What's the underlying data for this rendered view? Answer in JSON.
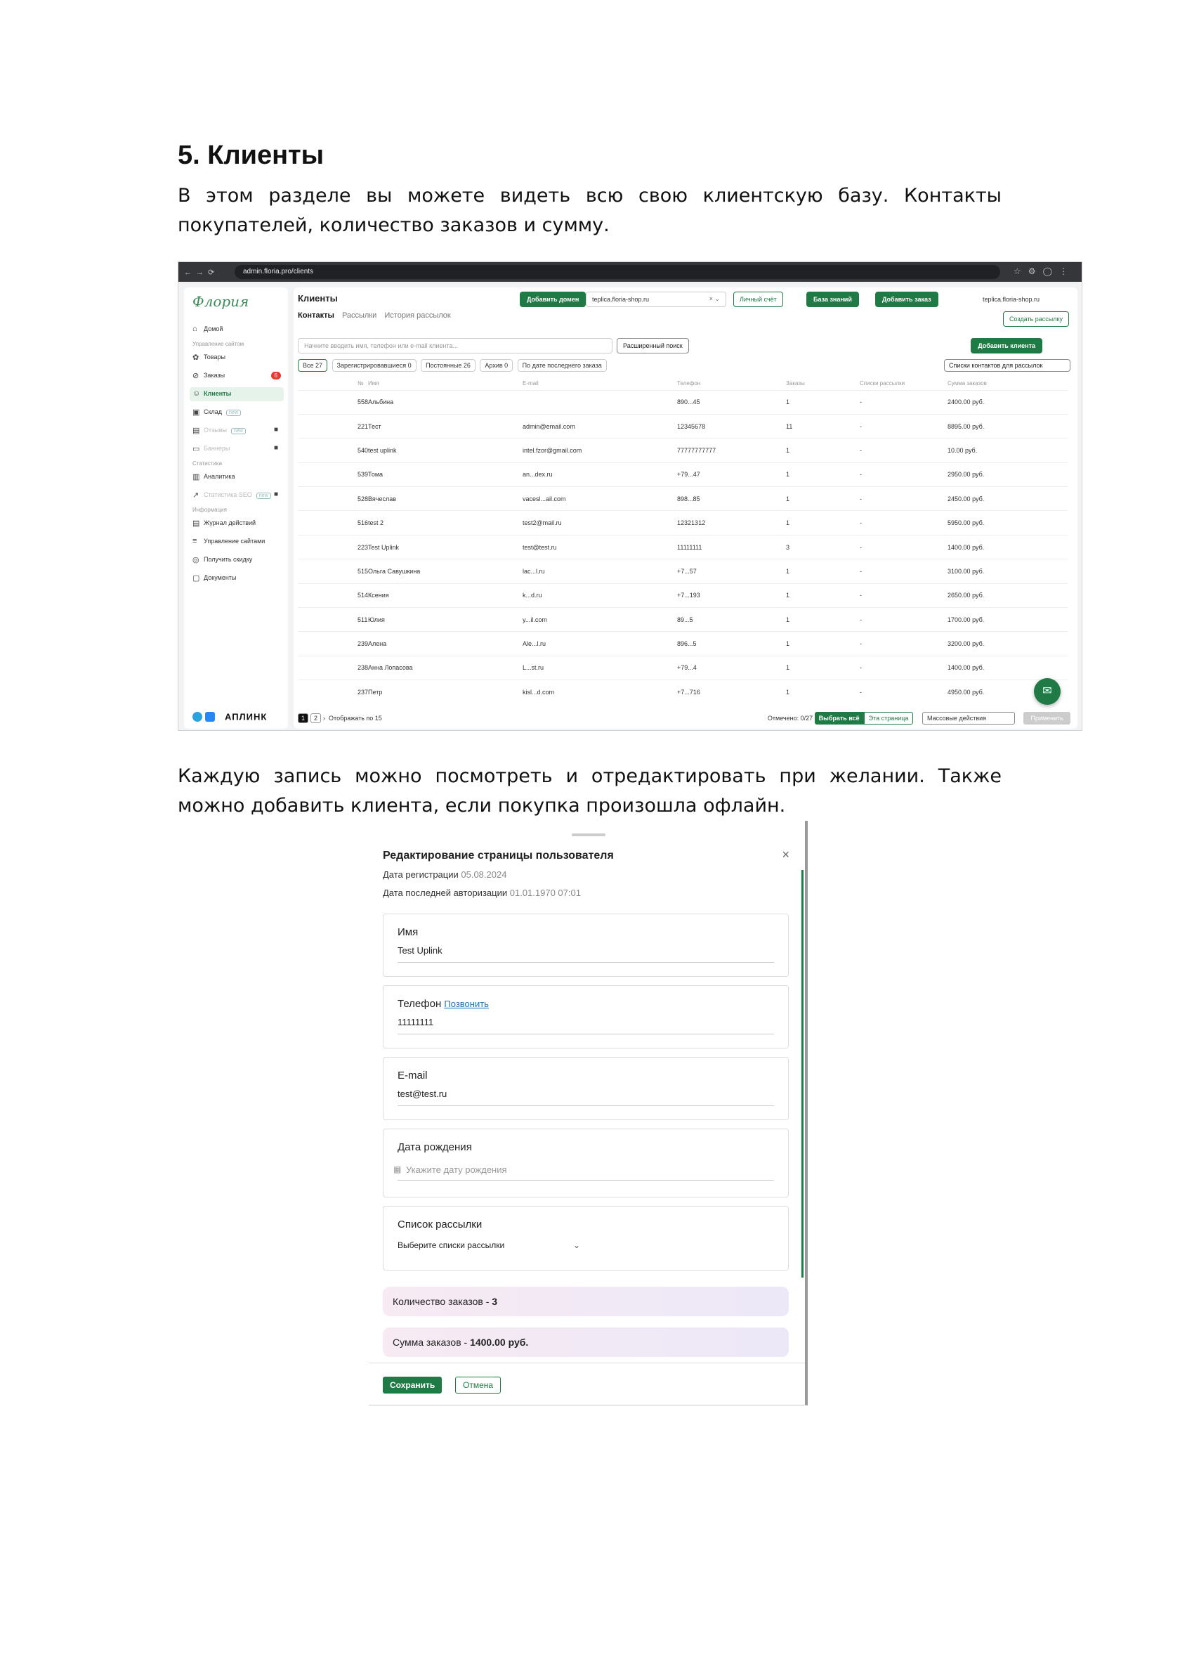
{
  "heading": "5. Клиенты",
  "paragraph1": "В этом разделе вы можете видеть всю свою клиентскую базу. Контакты покупателей, количество заказов и сумму.",
  "paragraph2": "Каждую запись можно посмотреть и отредактировать при желании. Также можно добавить клиента, если покупка произошла офлайн.",
  "screenshot1": {
    "browser": {
      "url": "admin.floria.pro/clients"
    },
    "sidebar": {
      "logo": "Флория",
      "items": [
        {
          "label": "Домой",
          "icon": "home-icon"
        },
        {
          "label": "Товары",
          "icon": "flower-icon"
        },
        {
          "label": "Заказы",
          "icon": "orders-icon",
          "badge": "6"
        },
        {
          "label": "Клиенты",
          "icon": "clients-icon"
        },
        {
          "label": "Склад",
          "icon": "box-icon",
          "tag": "new"
        },
        {
          "label": "Отзывы",
          "icon": "reviews-icon",
          "tag": "new"
        },
        {
          "label": "Баннеры",
          "icon": "banner-icon"
        },
        {
          "label": "Аналитика",
          "icon": "chart-icon"
        },
        {
          "label": "Статистика SEO",
          "icon": "seo-icon",
          "tag": "new"
        },
        {
          "label": "Журнал действий",
          "icon": "journal-icon"
        },
        {
          "label": "Управление сайтами",
          "icon": "sites-icon"
        },
        {
          "label": "Получить скидку",
          "icon": "discount-icon"
        },
        {
          "label": "Документы",
          "icon": "docs-icon"
        }
      ],
      "sections": [
        "Управление сайтом",
        "Статистика",
        "Информация"
      ],
      "footer_brand": "АПЛИНК"
    },
    "header": {
      "title": "Клиенты",
      "tabs": [
        "Контакты",
        "Рассылки",
        "История рассылок"
      ],
      "add_domain": "Добавить домен",
      "domain": "teplica.floria-shop.ru",
      "personal_account": "Личный счёт",
      "knowledge_base": "База знаний",
      "add_order": "Добавить заказ",
      "shop": "teplica.floria-shop.ru",
      "create_mailing": "Создать рассылку",
      "add_client": "Добавить клиента"
    },
    "search": {
      "placeholder": "Начните вводить имя, телефон или e-mail клиента...",
      "advanced": "Расширенный поиск"
    },
    "filters": [
      "Все 27",
      "Зарегистрировавшиеся 0",
      "Постоянные 26",
      "Архив 0",
      "По дате последнего заказа"
    ],
    "mailing_lists": "Списки контактов для рассылок",
    "columns": [
      "№",
      "Имя",
      "E-mail",
      "Телефон",
      "Заказы",
      "Списки рассылки",
      "Сумма заказов"
    ],
    "rows": [
      [
        "558",
        "Альбина",
        "",
        "890...45",
        "1",
        "-",
        "2400.00 руб."
      ],
      [
        "221",
        "Тест",
        "admin@email.com",
        "12345678",
        "11",
        "-",
        "8895.00 руб."
      ],
      [
        "540",
        "test uplink",
        "intel.fzor@gmail.com",
        "77777777777",
        "1",
        "-",
        "10.00 руб."
      ],
      [
        "539",
        "Тома",
        "an...dex.ru",
        "+79...47",
        "1",
        "-",
        "2950.00 руб."
      ],
      [
        "528",
        "Вячеслав",
        "vacesl...ail.com",
        "898...85",
        "1",
        "-",
        "2450.00 руб."
      ],
      [
        "516",
        "test 2",
        "test2@mail.ru",
        "12321312",
        "1",
        "-",
        "5950.00 руб."
      ],
      [
        "223",
        "Test Uplink",
        "test@test.ru",
        "11111111",
        "3",
        "-",
        "1400.00 руб."
      ],
      [
        "515",
        "Ольга Савушкина",
        "lac...l.ru",
        "+7...57",
        "1",
        "-",
        "3100.00 руб."
      ],
      [
        "514",
        "Ксения",
        "k...d.ru",
        "+7...193",
        "1",
        "-",
        "2650.00 руб."
      ],
      [
        "511",
        "Юлия",
        "y...il.com",
        "89...5",
        "1",
        "-",
        "1700.00 руб."
      ],
      [
        "239",
        "Алена",
        "Ale...l.ru",
        "896...5",
        "1",
        "-",
        "3200.00 руб."
      ],
      [
        "238",
        "Анна Лопасова",
        "L...st.ru",
        "+79...4",
        "1",
        "-",
        "1400.00 руб."
      ],
      [
        "237",
        "Петр",
        "kisl...d.com",
        "+7...716",
        "1",
        "-",
        "4950.00 руб."
      ]
    ],
    "pager": {
      "pages": [
        "1",
        "2"
      ],
      "per_page": "Отображать по 15"
    },
    "bulk": {
      "marked": "Отмечено: 0/27",
      "select_all": "Выбрать всё",
      "this_page": "Эта страница",
      "mass_actions": "Массовые действия",
      "apply": "Применить"
    }
  },
  "screenshot2": {
    "title": "Редактирование страницы пользователя",
    "reg_label": "Дата регистрации",
    "reg_value": "05.08.2024",
    "auth_label": "Дата последней авторизации",
    "auth_value": "01.01.1970 07:01",
    "name_label": "Имя",
    "name_value": "Test Uplink",
    "phone_label": "Телефон",
    "phone_call": "Позвонить",
    "phone_value": "11111111",
    "email_label": "E-mail",
    "email_value": "test@test.ru",
    "birth_label": "Дата рождения",
    "birth_placeholder": "Укажите дату рождения",
    "list_label": "Список рассылки",
    "list_value": "Выберите списки рассылки",
    "orders_label": "Количество заказов - ",
    "orders_value": "3",
    "sum_label": "Сумма заказов - ",
    "sum_value": "1400.00 руб.",
    "save": "Сохранить",
    "cancel": "Отмена"
  }
}
